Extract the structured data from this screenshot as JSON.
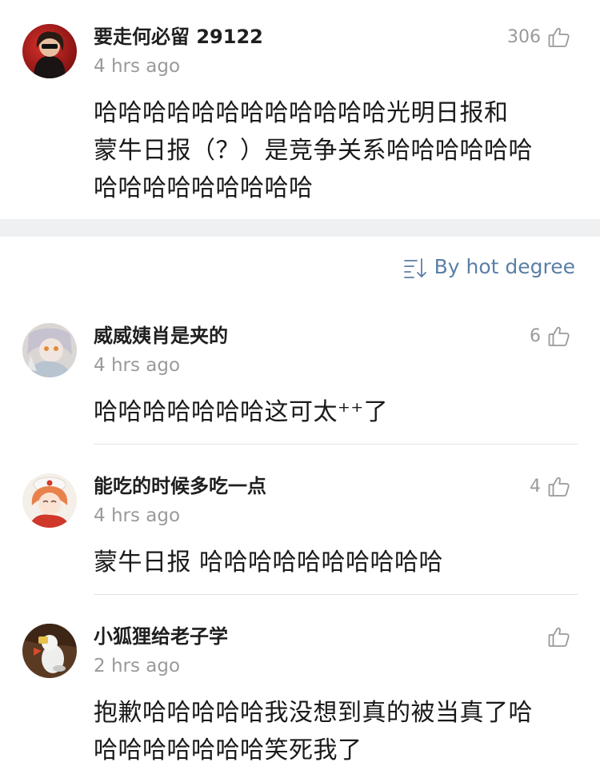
{
  "top_comment": {
    "username": "要走何必留 29122",
    "time": "4 hrs ago",
    "likes": "306",
    "lines": [
      "哈哈哈哈哈哈哈哈哈哈哈哈光明日报和",
      "蒙牛日报（？）是竞争关系哈哈哈哈哈哈",
      "哈哈哈哈哈哈哈哈哈"
    ]
  },
  "sort": {
    "label": "By hot degree",
    "icon": "sort-icon"
  },
  "comments": [
    {
      "username": "威威姨肖是夹的",
      "time": "4 hrs ago",
      "likes": "6",
      "lines": [
        "哈哈哈哈哈哈哈这可太⁺⁺了"
      ]
    },
    {
      "username": "能吃的时候多吃一点",
      "time": "4 hrs ago",
      "likes": "4",
      "lines": [
        "蒙牛日报 哈哈哈哈哈哈哈哈哈哈"
      ]
    },
    {
      "username": "小狐狸给老子学",
      "time": "2 hrs ago",
      "likes": "",
      "lines": [
        "抱歉哈哈哈哈哈我没想到真的被当真了哈",
        "哈哈哈哈哈哈哈笑死我了"
      ]
    }
  ],
  "icons": {
    "like": "thumbs-up-icon",
    "sort": "sort-lines-icon"
  },
  "colors": {
    "accent_link": "#5b7fa5",
    "muted_text": "#9a9a9a",
    "section_gap": "#eef0f2"
  }
}
